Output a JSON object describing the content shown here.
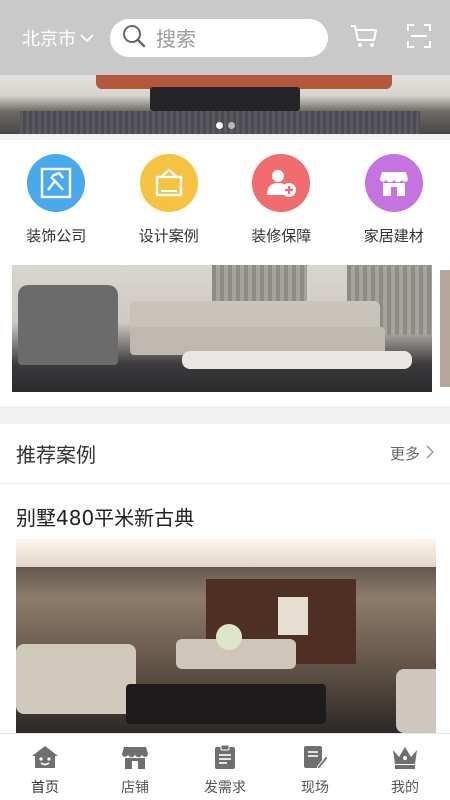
{
  "header": {
    "city": "北京市",
    "search_placeholder": "搜索",
    "icons": [
      "chevron-down-icon",
      "search-icon",
      "cart-icon",
      "scan-icon"
    ]
  },
  "hero_banner": {
    "slide_count": 2,
    "active_slide": 1
  },
  "categories": [
    {
      "label": "装饰公司",
      "icon": "company-icon",
      "color": "#4aa8ec"
    },
    {
      "label": "设计案例",
      "icon": "design-case-icon",
      "color": "#f5c242"
    },
    {
      "label": "装修保障",
      "icon": "guarantee-icon",
      "color": "#f16c6e"
    },
    {
      "label": "家居建材",
      "icon": "store-icon",
      "color": "#c573e0"
    }
  ],
  "recommended": {
    "title": "推荐案例",
    "more_label": "更多",
    "case_title": "别墅480平米新古典"
  },
  "tabbar": {
    "items": [
      {
        "label": "首页",
        "icon": "home-icon",
        "active": true
      },
      {
        "label": "店铺",
        "icon": "shop-icon",
        "active": false
      },
      {
        "label": "发需求",
        "icon": "post-demand-icon",
        "active": false
      },
      {
        "label": "现场",
        "icon": "site-icon",
        "active": false
      },
      {
        "label": "我的",
        "icon": "profile-crown-icon",
        "active": false
      }
    ]
  },
  "colors": {
    "header_bg": "#c9c9c9",
    "page_bg": "#f2f2f2",
    "tab_icon": "#6f6f6f"
  }
}
